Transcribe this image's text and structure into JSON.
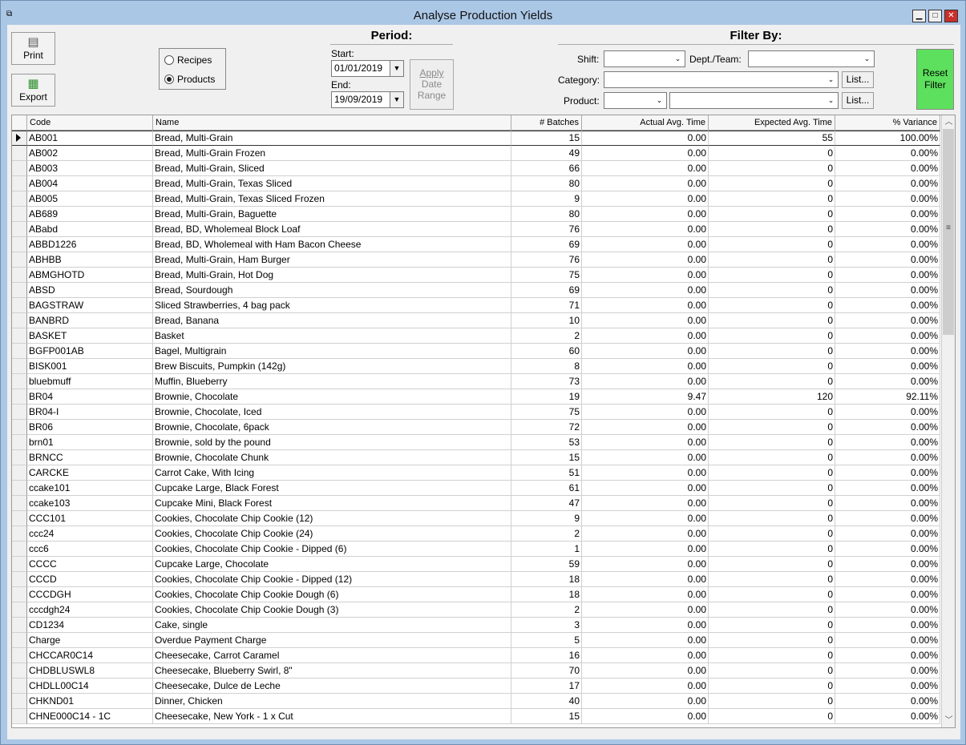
{
  "window": {
    "title": "Analyse Production Yields",
    "min": "▁",
    "max": "□",
    "close": "✕"
  },
  "toolbar": {
    "print_label": "Print",
    "export_label": "Export",
    "print_icon": "printer-icon",
    "export_icon": "spreadsheet-icon"
  },
  "mode": {
    "recipes": "Recipes",
    "products": "Products",
    "selected": "Products"
  },
  "period": {
    "title": "Period:",
    "start_label": "Start:",
    "start_value": "01/01/2019",
    "end_label": "End:",
    "end_value": "19/09/2019",
    "apply_line1": "Apply",
    "apply_line2": "Date",
    "apply_line3": "Range"
  },
  "filter": {
    "title": "Filter By:",
    "shift_label": "Shift:",
    "dept_label": "Dept./Team:",
    "category_label": "Category:",
    "product_label": "Product:",
    "list1": "List...",
    "list2": "List...",
    "reset_line1": "Reset",
    "reset_line2": "Filter",
    "reset_color": "#5de05d"
  },
  "grid": {
    "columns": [
      "Code",
      "Name",
      "# Batches",
      "Actual Avg. Time",
      "Expected Avg. Time",
      "% Variance"
    ],
    "rows": [
      [
        "AB001",
        "Bread, Multi-Grain",
        "15",
        "0.00",
        "55",
        "100.00%"
      ],
      [
        "AB002",
        "Bread, Multi-Grain Frozen",
        "49",
        "0.00",
        "0",
        "0.00%"
      ],
      [
        "AB003",
        "Bread, Multi-Grain, Sliced",
        "66",
        "0.00",
        "0",
        "0.00%"
      ],
      [
        "AB004",
        "Bread, Multi-Grain, Texas Sliced",
        "80",
        "0.00",
        "0",
        "0.00%"
      ],
      [
        "AB005",
        "Bread, Multi-Grain, Texas Sliced Frozen",
        "9",
        "0.00",
        "0",
        "0.00%"
      ],
      [
        "AB689",
        "Bread, Multi-Grain, Baguette",
        "80",
        "0.00",
        "0",
        "0.00%"
      ],
      [
        "ABabd",
        "Bread, BD, Wholemeal Block Loaf",
        "76",
        "0.00",
        "0",
        "0.00%"
      ],
      [
        "ABBD1226",
        "Bread, BD, Wholemeal with Ham Bacon Cheese",
        "69",
        "0.00",
        "0",
        "0.00%"
      ],
      [
        "ABHBB",
        "Bread, Multi-Grain, Ham Burger",
        "76",
        "0.00",
        "0",
        "0.00%"
      ],
      [
        "ABMGHOTD",
        "Bread, Multi-Grain, Hot Dog",
        "75",
        "0.00",
        "0",
        "0.00%"
      ],
      [
        "ABSD",
        "Bread, Sourdough",
        "69",
        "0.00",
        "0",
        "0.00%"
      ],
      [
        "BAGSTRAW",
        "Sliced Strawberries, 4 bag pack",
        "71",
        "0.00",
        "0",
        "0.00%"
      ],
      [
        "BANBRD",
        "Bread, Banana",
        "10",
        "0.00",
        "0",
        "0.00%"
      ],
      [
        "BASKET",
        "Basket",
        "2",
        "0.00",
        "0",
        "0.00%"
      ],
      [
        "BGFP001AB",
        "Bagel, Multigrain",
        "60",
        "0.00",
        "0",
        "0.00%"
      ],
      [
        "BISK001",
        "Brew Biscuits, Pumpkin (142g)",
        "8",
        "0.00",
        "0",
        "0.00%"
      ],
      [
        "bluebmuff",
        "Muffin, Blueberry",
        "73",
        "0.00",
        "0",
        "0.00%"
      ],
      [
        "BR04",
        "Brownie, Chocolate",
        "19",
        "9.47",
        "120",
        "92.11%"
      ],
      [
        "BR04-I",
        "Brownie, Chocolate, Iced",
        "75",
        "0.00",
        "0",
        "0.00%"
      ],
      [
        "BR06",
        "Brownie, Chocolate, 6pack",
        "72",
        "0.00",
        "0",
        "0.00%"
      ],
      [
        "brn01",
        "Brownie, sold by the pound",
        "53",
        "0.00",
        "0",
        "0.00%"
      ],
      [
        "BRNCC",
        "Brownie, Chocolate Chunk",
        "15",
        "0.00",
        "0",
        "0.00%"
      ],
      [
        "CARCKE",
        "Carrot Cake, With Icing",
        "51",
        "0.00",
        "0",
        "0.00%"
      ],
      [
        "ccake101",
        "Cupcake Large, Black Forest",
        "61",
        "0.00",
        "0",
        "0.00%"
      ],
      [
        "ccake103",
        "Cupcake Mini, Black Forest",
        "47",
        "0.00",
        "0",
        "0.00%"
      ],
      [
        "CCC101",
        "Cookies, Chocolate Chip Cookie (12)",
        "9",
        "0.00",
        "0",
        "0.00%"
      ],
      [
        "ccc24",
        "Cookies, Chocolate Chip Cookie (24)",
        "2",
        "0.00",
        "0",
        "0.00%"
      ],
      [
        "ccc6",
        "Cookies, Chocolate Chip Cookie - Dipped (6)",
        "1",
        "0.00",
        "0",
        "0.00%"
      ],
      [
        "CCCC",
        "Cupcake Large, Chocolate",
        "59",
        "0.00",
        "0",
        "0.00%"
      ],
      [
        "CCCD",
        "Cookies, Chocolate Chip Cookie - Dipped (12)",
        "18",
        "0.00",
        "0",
        "0.00%"
      ],
      [
        "CCCDGH",
        "Cookies, Chocolate Chip Cookie Dough (6)",
        "18",
        "0.00",
        "0",
        "0.00%"
      ],
      [
        "cccdgh24",
        "Cookies, Chocolate Chip Cookie Dough (3)",
        "2",
        "0.00",
        "0",
        "0.00%"
      ],
      [
        "CD1234",
        "Cake, single",
        "3",
        "0.00",
        "0",
        "0.00%"
      ],
      [
        "Charge",
        "Overdue Payment Charge",
        "5",
        "0.00",
        "0",
        "0.00%"
      ],
      [
        "CHCCAR0C14",
        "Cheesecake, Carrot Caramel",
        "16",
        "0.00",
        "0",
        "0.00%"
      ],
      [
        "CHDBLUSWL8",
        "Cheesecake, Blueberry Swirl, 8\"",
        "70",
        "0.00",
        "0",
        "0.00%"
      ],
      [
        "CHDLL00C14",
        "Cheesecake, Dulce de Leche",
        "17",
        "0.00",
        "0",
        "0.00%"
      ],
      [
        "CHKND01",
        "Dinner, Chicken",
        "40",
        "0.00",
        "0",
        "0.00%"
      ],
      [
        "CHNE000C14 - 1C",
        "Cheesecake, New York - 1 x Cut",
        "15",
        "0.00",
        "0",
        "0.00%"
      ]
    ]
  }
}
